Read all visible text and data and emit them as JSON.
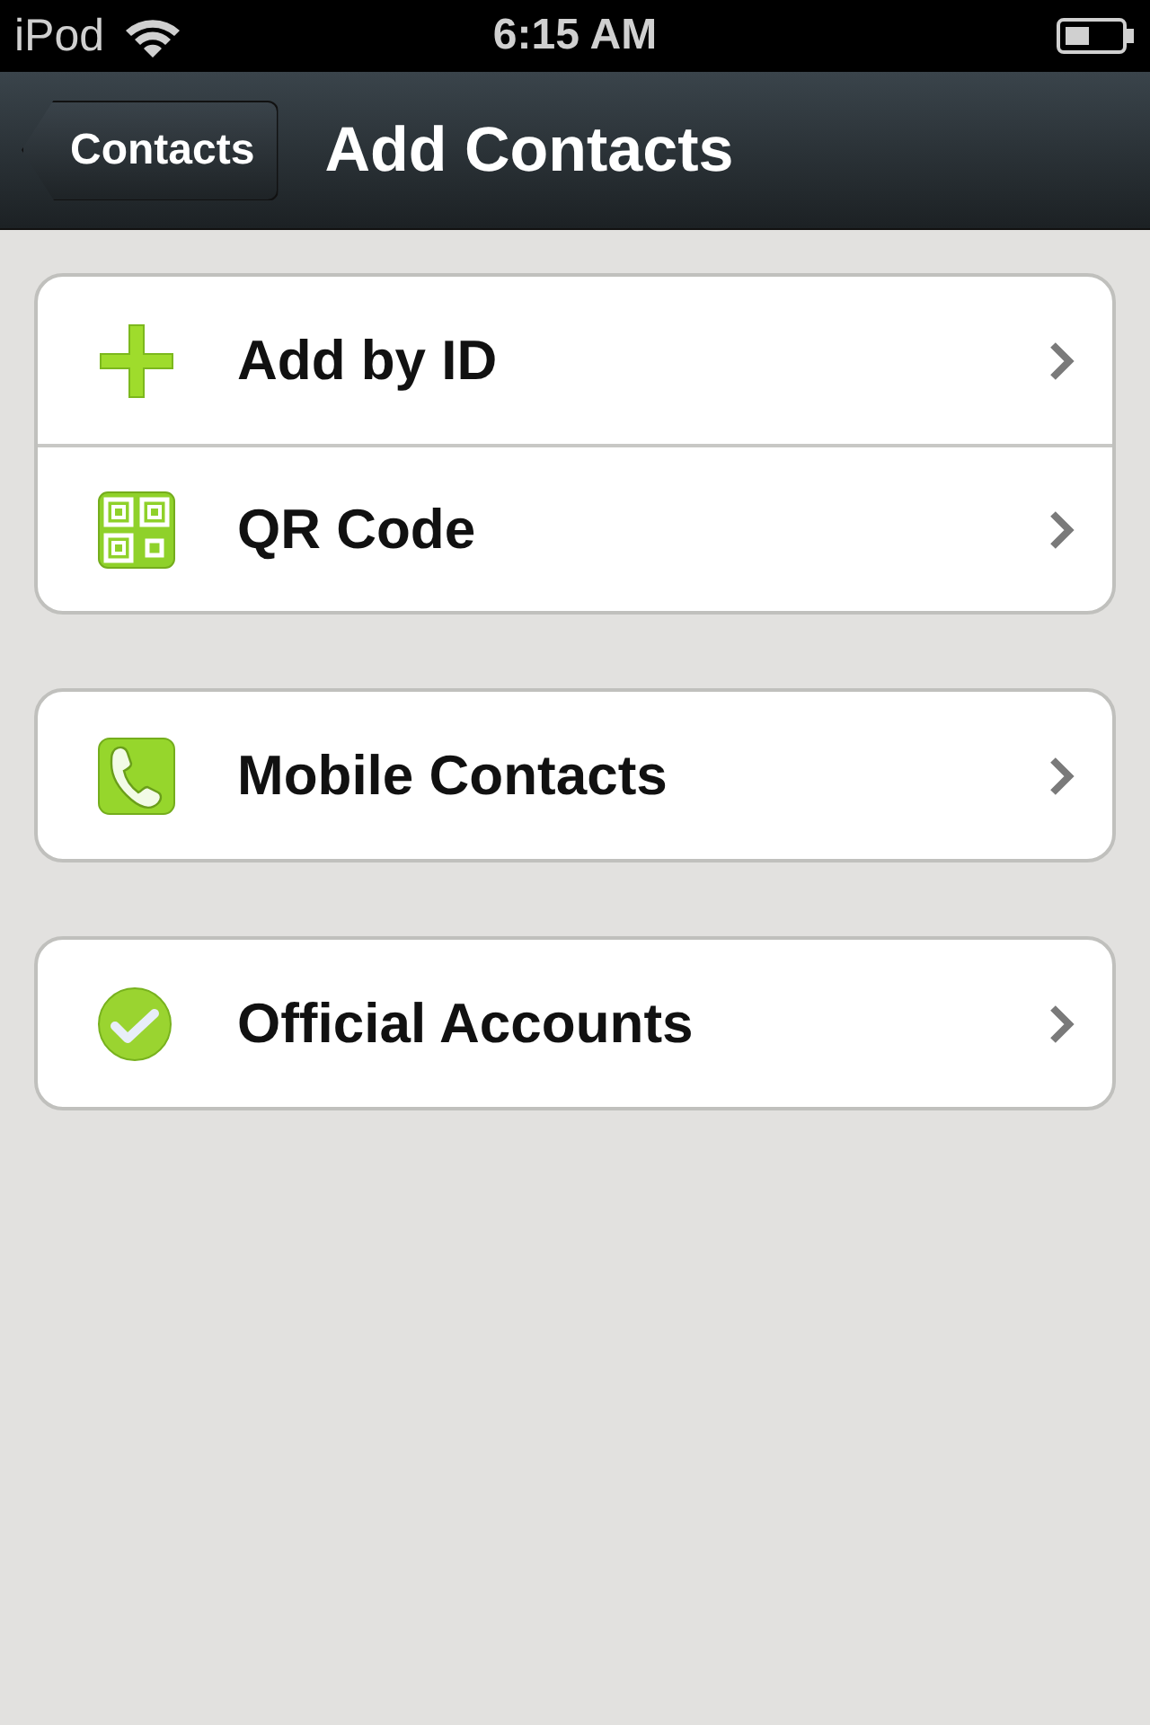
{
  "status_bar": {
    "carrier": "iPod",
    "time": "6:15 AM"
  },
  "nav_bar": {
    "back_button": "Contacts",
    "title": "Add Contacts"
  },
  "groups": [
    {
      "items": [
        {
          "kind": "plus",
          "label": "Add by ID"
        },
        {
          "kind": "qr",
          "label": "QR Code"
        }
      ]
    },
    {
      "items": [
        {
          "kind": "phone",
          "label": "Mobile Contacts"
        }
      ]
    },
    {
      "items": [
        {
          "kind": "check",
          "label": "Official Accounts"
        }
      ]
    }
  ]
}
